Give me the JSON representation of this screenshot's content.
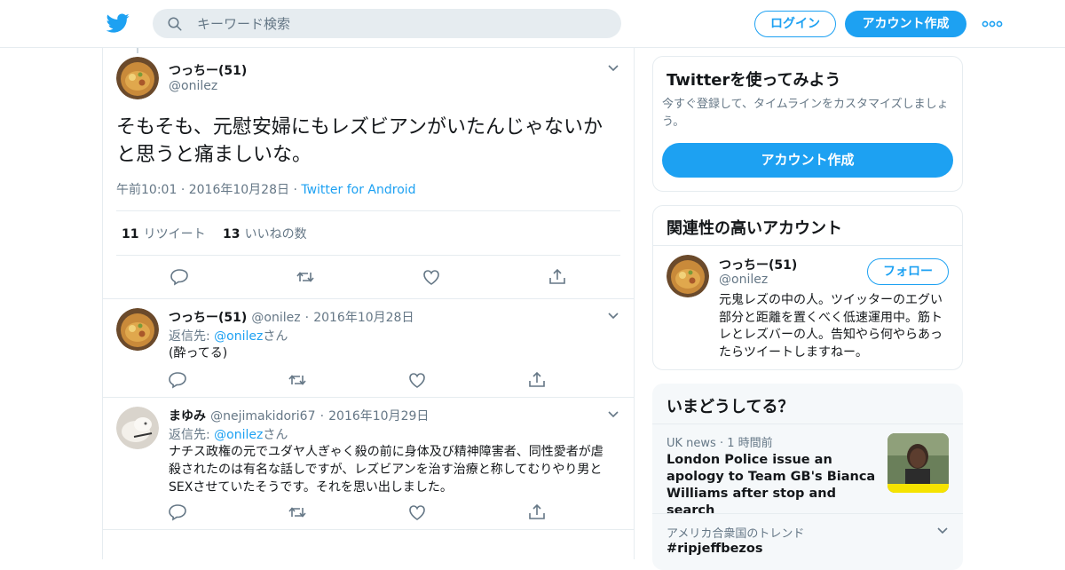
{
  "header": {
    "search_placeholder": "キーワード検索",
    "login_label": "ログイン",
    "signup_label": "アカウント作成"
  },
  "main_tweet": {
    "name": "つっちー(51)",
    "handle": "@onilez",
    "text": "そもそも、元慰安婦にもレズビアンがいたんじゃないかと思うと痛ましいな。",
    "time": "午前10:01",
    "sep1": "·",
    "date": "2016年10月28日",
    "sep2": "·",
    "source": "Twitter for Android",
    "retweets_count": "11",
    "retweets_label": "リツイート",
    "likes_count": "13",
    "likes_label": "いいねの数"
  },
  "replies": [
    {
      "name": "つっちー(51)",
      "handle": "@onilez",
      "sep": "·",
      "date": "2016年10月28日",
      "reply_prefix": "返信先:",
      "reply_handle": "@onilez",
      "reply_suffix": "さん",
      "text": "(酔ってる)"
    },
    {
      "name": "まゆみ",
      "handle": "@nejimakidori67",
      "sep": "·",
      "date": "2016年10月29日",
      "reply_prefix": "返信先:",
      "reply_handle": "@onilez",
      "reply_suffix": "さん",
      "text": "ナチス政権の元でユダヤ人ぎゃく殺の前に身体及び精神障害者、同性愛者が虐殺されたのは有名な話しですが、レズビアンを治す治療と称してむりやり男とSEXさせていたそうです。それを思い出しました。"
    }
  ],
  "sidebar": {
    "try_card": {
      "title": "Twitterを使ってみよう",
      "subtitle": "今すぐ登録して、タイムラインをカスタマイズしましょう。",
      "button": "アカウント作成"
    },
    "related": {
      "title": "関連性の高いアカウント",
      "name": "つっちー(51)",
      "handle": "@onilez",
      "follow": "フォロー",
      "bio": "元鬼レズの中の人。ツイッターのエグい部分と距離を置くべく低速運用中。筋トレとレズバーの人。告知やら何やらあったらツイートしますねー。"
    },
    "trends": {
      "title": "いまどうしてる？",
      "news_source": "UK news",
      "news_sep": "·",
      "news_time": "1 時間前",
      "news_headline": "London Police issue an apology to Team GB's Bianca Williams after stop and search",
      "trend_meta": "アメリカ合衆国のトレンド",
      "trend_tag": "#ripjeffbezos"
    }
  },
  "colors": {
    "accent": "#1da1f2",
    "secondary_text": "#657786",
    "border": "#e6ecf0"
  }
}
